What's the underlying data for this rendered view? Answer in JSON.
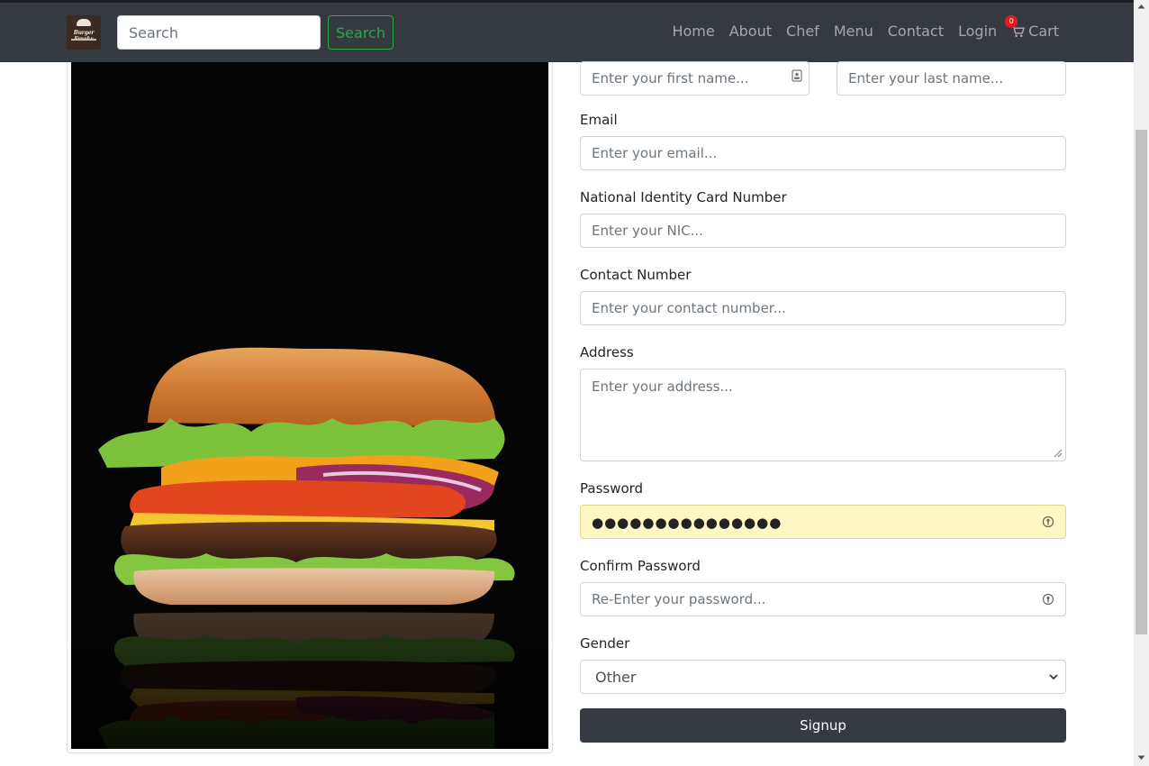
{
  "navbar": {
    "logo_text": "Burger Freaks",
    "search_placeholder": "Search",
    "search_button": "Search",
    "links": [
      "Home",
      "About",
      "Chef",
      "Menu",
      "Contact",
      "Login"
    ],
    "cart_label": "Cart",
    "cart_count": "0"
  },
  "form": {
    "first_name_placeholder": "Enter your first name...",
    "last_name_placeholder": "Enter your last name...",
    "email_label": "Email",
    "email_placeholder": "Enter your email...",
    "nic_label": "National Identity Card Number",
    "nic_placeholder": "Enter your NIC...",
    "contact_label": "Contact Number",
    "contact_placeholder": "Enter your contact number...",
    "address_label": "Address",
    "address_placeholder": "Enter your address...",
    "password_label": "Password",
    "password_value": "●●●●●●●●●●●●●●●",
    "confirm_label": "Confirm Password",
    "confirm_placeholder": "Re-Enter your password...",
    "gender_label": "Gender",
    "gender_value": "Other",
    "submit_label": "Signup"
  },
  "colors": {
    "navbar": "#343a40",
    "search_button": "#28a745",
    "autofill": "#fef7c3",
    "cart_badge": "#e31b1b"
  },
  "icons": {
    "cart": "shopping-cart-icon",
    "contact_card": "contact-card-icon",
    "password_key": "password-manager-icon"
  }
}
